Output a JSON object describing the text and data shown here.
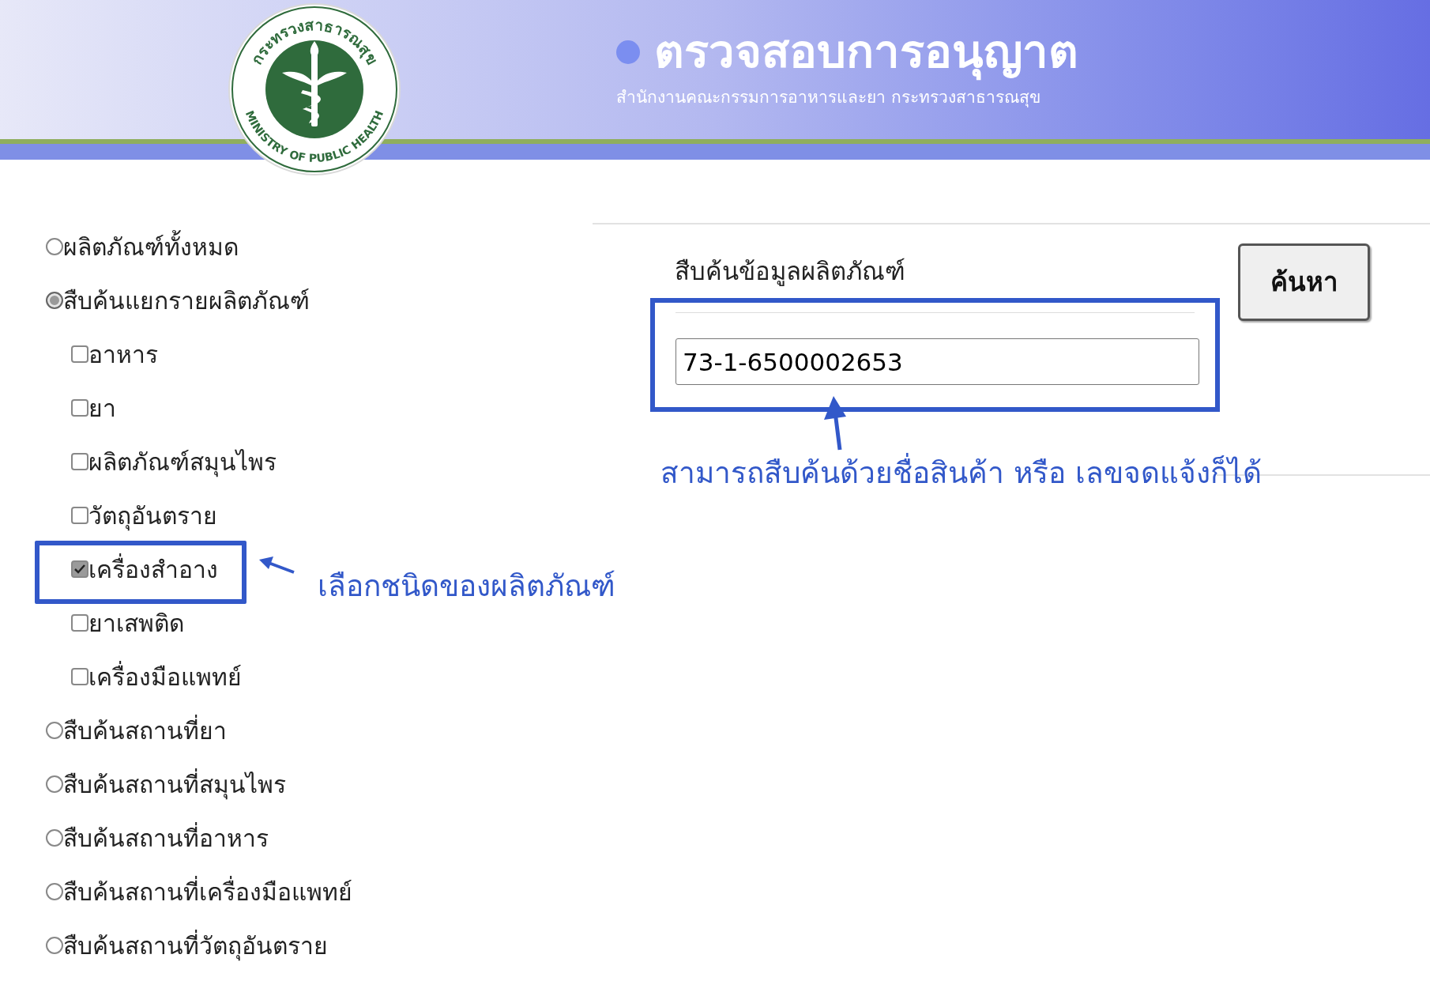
{
  "header": {
    "logo": {
      "text_top": "กระทรวงสาธารณสุข",
      "text_bottom": "MINISTRY OF PUBLIC HEALTH"
    },
    "title": "ตรวจสอบการอนุญาต",
    "subtitle": "สำนักงานคณะกรรมการอาหารและยา กระทรวงสาธารณสุข"
  },
  "options": [
    {
      "kind": "radio",
      "label": "ผลิตภัณฑ์ทั้งหมด",
      "selected": false
    },
    {
      "kind": "radio",
      "label": "สืบค้นแยกรายผลิตภัณฑ์",
      "selected": true,
      "children": [
        {
          "kind": "checkbox",
          "label": "อาหาร",
          "checked": false
        },
        {
          "kind": "checkbox",
          "label": "ยา",
          "checked": false
        },
        {
          "kind": "checkbox",
          "label": "ผลิตภัณฑ์สมุนไพร",
          "checked": false
        },
        {
          "kind": "checkbox",
          "label": "วัตถุอันตราย",
          "checked": false
        },
        {
          "kind": "checkbox",
          "label": "เครื่องสำอาง",
          "checked": true
        },
        {
          "kind": "checkbox",
          "label": "ยาเสพติด",
          "checked": false
        },
        {
          "kind": "checkbox",
          "label": "เครื่องมือแพทย์",
          "checked": false
        }
      ]
    },
    {
      "kind": "radio",
      "label": "สืบค้นสถานที่ยา",
      "selected": false
    },
    {
      "kind": "radio",
      "label": "สืบค้นสถานที่สมุนไพร",
      "selected": false
    },
    {
      "kind": "radio",
      "label": "สืบค้นสถานที่อาหาร",
      "selected": false
    },
    {
      "kind": "radio",
      "label": "สืบค้นสถานที่เครื่องมือแพทย์",
      "selected": false
    },
    {
      "kind": "radio",
      "label": "สืบค้นสถานที่วัตถุอันตราย",
      "selected": false
    }
  ],
  "search": {
    "heading": "สืบค้นข้อมูลผลิตภัณฑ์",
    "value": "73-1-6500002653",
    "button": "ค้นหา"
  },
  "annotations": {
    "type_hint": "เลือกชนิดของผลิตภัณฑ์",
    "search_hint": "สามารถสืบค้นด้วยชื่อสินค้า หรือ เลขจดแจ้งก็ได้"
  }
}
